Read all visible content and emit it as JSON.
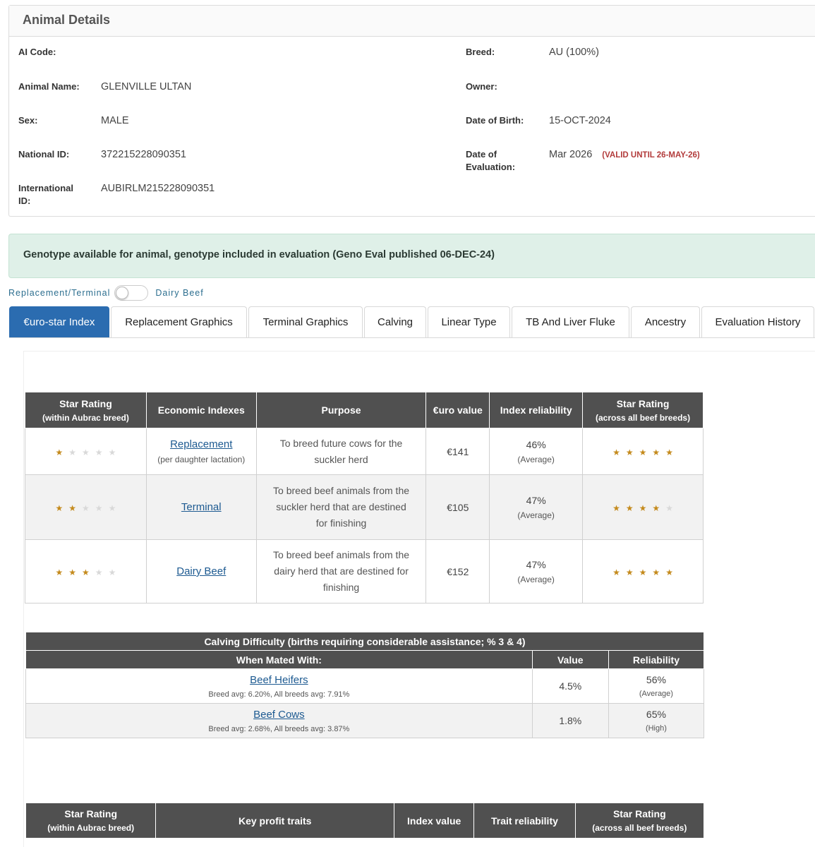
{
  "panel": {
    "title": "Animal Details",
    "fields": {
      "ai_code": {
        "label": "AI Code:",
        "value": ""
      },
      "animal_name": {
        "label": "Animal Name:",
        "value": "GLENVILLE ULTAN"
      },
      "sex": {
        "label": "Sex:",
        "value": "MALE"
      },
      "national_id": {
        "label": "National ID:",
        "value": "372215228090351"
      },
      "international_id": {
        "label": "International ID:",
        "value": "AUBIRLM215228090351"
      },
      "breed": {
        "label": "Breed:",
        "value": "AU (100%)"
      },
      "owner": {
        "label": "Owner:",
        "value": ""
      },
      "dob": {
        "label": "Date of Birth:",
        "value": "15-OCT-2024"
      },
      "date_of_evaluation": {
        "label": "Date of Evaluation:",
        "value": "Mar 2026",
        "note": "(VALID UNTIL 26-MAY-26)"
      }
    }
  },
  "alert": {
    "text": "Genotype available for animal, genotype included in evaluation (Geno Eval published 06-DEC-24)"
  },
  "toggle": {
    "left_label": "Replacement/Terminal",
    "right_label": "Dairy Beef"
  },
  "tabs": [
    {
      "label": "€uro-star Index"
    },
    {
      "label": "Replacement Graphics"
    },
    {
      "label": "Terminal Graphics"
    },
    {
      "label": "Calving"
    },
    {
      "label": "Linear Type"
    },
    {
      "label": "TB And Liver Fluke"
    },
    {
      "label": "Ancestry"
    },
    {
      "label": "Evaluation History"
    }
  ],
  "index_table": {
    "headers": {
      "star_within": "Star Rating",
      "star_within_sub": "(within Aubrac breed)",
      "economic": "Economic Indexes",
      "purpose": "Purpose",
      "euro": "€uro value",
      "reliability": "Index reliability",
      "star_across": "Star Rating",
      "star_across_sub": "(across all beef breeds)"
    },
    "rows": [
      {
        "stars_within": 1,
        "index": "Replacement",
        "index_sub": "(per daughter lactation)",
        "purpose": "To breed future cows for the suckler herd",
        "euro": "€141",
        "reliability": "46%",
        "reliability_sub": "(Average)",
        "stars_across": 5
      },
      {
        "stars_within": 2,
        "index": "Terminal",
        "index_sub": "",
        "purpose": "To breed beef animals from the suckler herd that are destined for finishing",
        "euro": "€105",
        "reliability": "47%",
        "reliability_sub": "(Average)",
        "stars_across": 4
      },
      {
        "stars_within": 3,
        "index": "Dairy Beef",
        "index_sub": "",
        "purpose": "To breed beef animals from the dairy herd that are destined for finishing",
        "euro": "€152",
        "reliability": "47%",
        "reliability_sub": "(Average)",
        "stars_across": 5
      }
    ]
  },
  "calving_table": {
    "title": "Calving Difficulty (births requiring considerable assistance; % 3 & 4)",
    "col_mated": "When Mated With:",
    "col_value": "Value",
    "col_reliability": "Reliability",
    "rows": [
      {
        "label": "Beef Heifers",
        "avg": "Breed avg: 6.20%, All breeds avg: 7.91%",
        "value": "4.5%",
        "reliability": "56%",
        "reliability_sub": "(Average)"
      },
      {
        "label": "Beef Cows",
        "avg": "Breed avg: 2.68%, All breeds avg: 3.87%",
        "value": "1.8%",
        "reliability": "65%",
        "reliability_sub": "(High)"
      }
    ]
  },
  "key_table": {
    "star_within": "Star Rating",
    "star_within_sub": "(within Aubrac breed)",
    "key_traits": "Key profit traits",
    "index_value": "Index value",
    "trait_reliability": "Trait reliability",
    "star_across": "Star Rating",
    "star_across_sub": "(across all beef breeds)"
  }
}
